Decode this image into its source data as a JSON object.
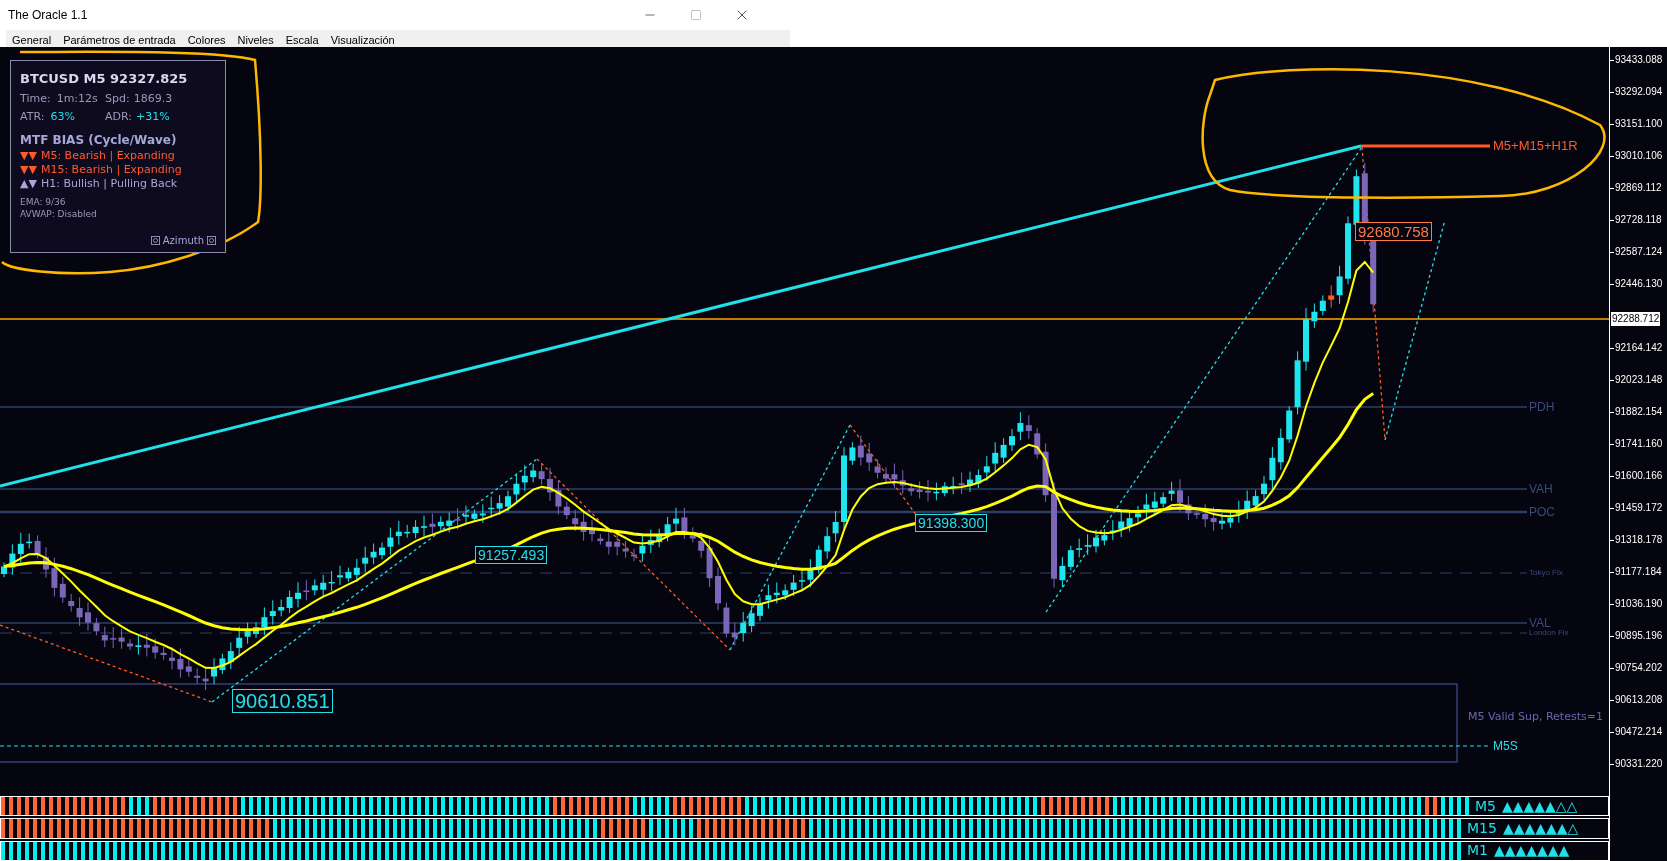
{
  "window": {
    "title": "The Oracle 1.1"
  },
  "menu": [
    "General",
    "Parámetros de entrada",
    "Colores",
    "Niveles",
    "Escala",
    "Visualización"
  ],
  "info_panel": {
    "title": "BTCUSD M5 92327.825",
    "stats": [
      [
        {
          "label": "Time:",
          "value": "1m:12s",
          "accent": false
        },
        {
          "label": "Spd:",
          "value": "1869.3",
          "accent": false
        }
      ],
      [
        {
          "label": "ATR:",
          "value": "63%",
          "accent": true
        },
        {
          "label": "ADR:",
          "value": "+31%",
          "accent": true
        }
      ]
    ],
    "bias_title": "MTF BIAS (Cycle/Wave)",
    "bias": [
      {
        "arrows": "▼▼",
        "text": "M5: Bearish | Expanding",
        "color": "#ff5a2a"
      },
      {
        "arrows": "▼▼",
        "text": "M15: Bearish | Expanding",
        "color": "#ff5a2a"
      },
      {
        "arrows": "▲▼",
        "text": "H1: Bullish | Pulling Back",
        "color": "#a8a8d8"
      }
    ],
    "notes": [
      "EMA: 9/36",
      "AVWAP: Disabled"
    ],
    "footer": "Azimuth"
  },
  "levels": [
    {
      "label": "PDH",
      "kind": "solid"
    },
    {
      "label": "VAH",
      "kind": "solid"
    },
    {
      "label": "POC",
      "kind": "thick"
    },
    {
      "label": "Tokyo Fix",
      "kind": "dashed"
    },
    {
      "label": "VAL",
      "kind": "solid"
    },
    {
      "label": "London Fix",
      "kind": "dashed"
    }
  ],
  "price_labels": [
    {
      "text": "92680.758",
      "color": "#ff7a45"
    },
    {
      "text": "91257.493",
      "color": "#22e0e8"
    },
    {
      "text": "91398.300",
      "color": "#22e0e8"
    },
    {
      "text": "90610.851",
      "color": "#22e0e8"
    }
  ],
  "resistance": {
    "label": "M5+M15+H1R"
  },
  "support_zone": {
    "label": "M5 Valid Sup, Retests=1",
    "line_label": "M5S"
  },
  "price_axis": {
    "ticks": [
      "93433.088",
      "93292.094",
      "93151.100",
      "93010.106",
      "92869.112",
      "92728.118",
      "92587.124",
      "92446.130",
      "92164.142",
      "92023.148",
      "91882.154",
      "91741.160",
      "91600.166",
      "91459.172",
      "91318.178",
      "91177.184",
      "91036.190",
      "90895.196",
      "90754.202",
      "90613.208",
      "90472.214",
      "90331.220"
    ],
    "current": "92288.712"
  },
  "signal_rows": [
    {
      "label": "M5",
      "signals": "▲▲▲▲▲△△",
      "segments": [
        {
          "color": "#ff6633"
        },
        {
          "color": "#00f0f0"
        },
        {
          "color": "#ff6633"
        },
        {
          "color": "#00f0f0"
        },
        {
          "color": "#ff6633"
        },
        {
          "color": "#00f0f0"
        },
        {
          "color": "#ff6633"
        },
        {
          "color": "#00f0f0"
        },
        {
          "color": "#ff6633"
        },
        {
          "color": "#00f0f0"
        },
        {
          "color": "#ff6633"
        },
        {
          "color": "#00f0f0"
        }
      ]
    },
    {
      "label": "M15",
      "signals": "▲▲▲▲▲▲△",
      "segments": [
        {
          "color": "#ff6633"
        },
        {
          "color": "#00f0f0"
        },
        {
          "color": "#ff6633"
        },
        {
          "color": "#00f0f0"
        },
        {
          "color": "#ff6633"
        },
        {
          "color": "#00f0f0"
        }
      ]
    },
    {
      "label": "M1",
      "signals": "▲▲▲▲▲▲▲",
      "segments": [
        {
          "color": "#00f0f0"
        }
      ]
    }
  ]
}
